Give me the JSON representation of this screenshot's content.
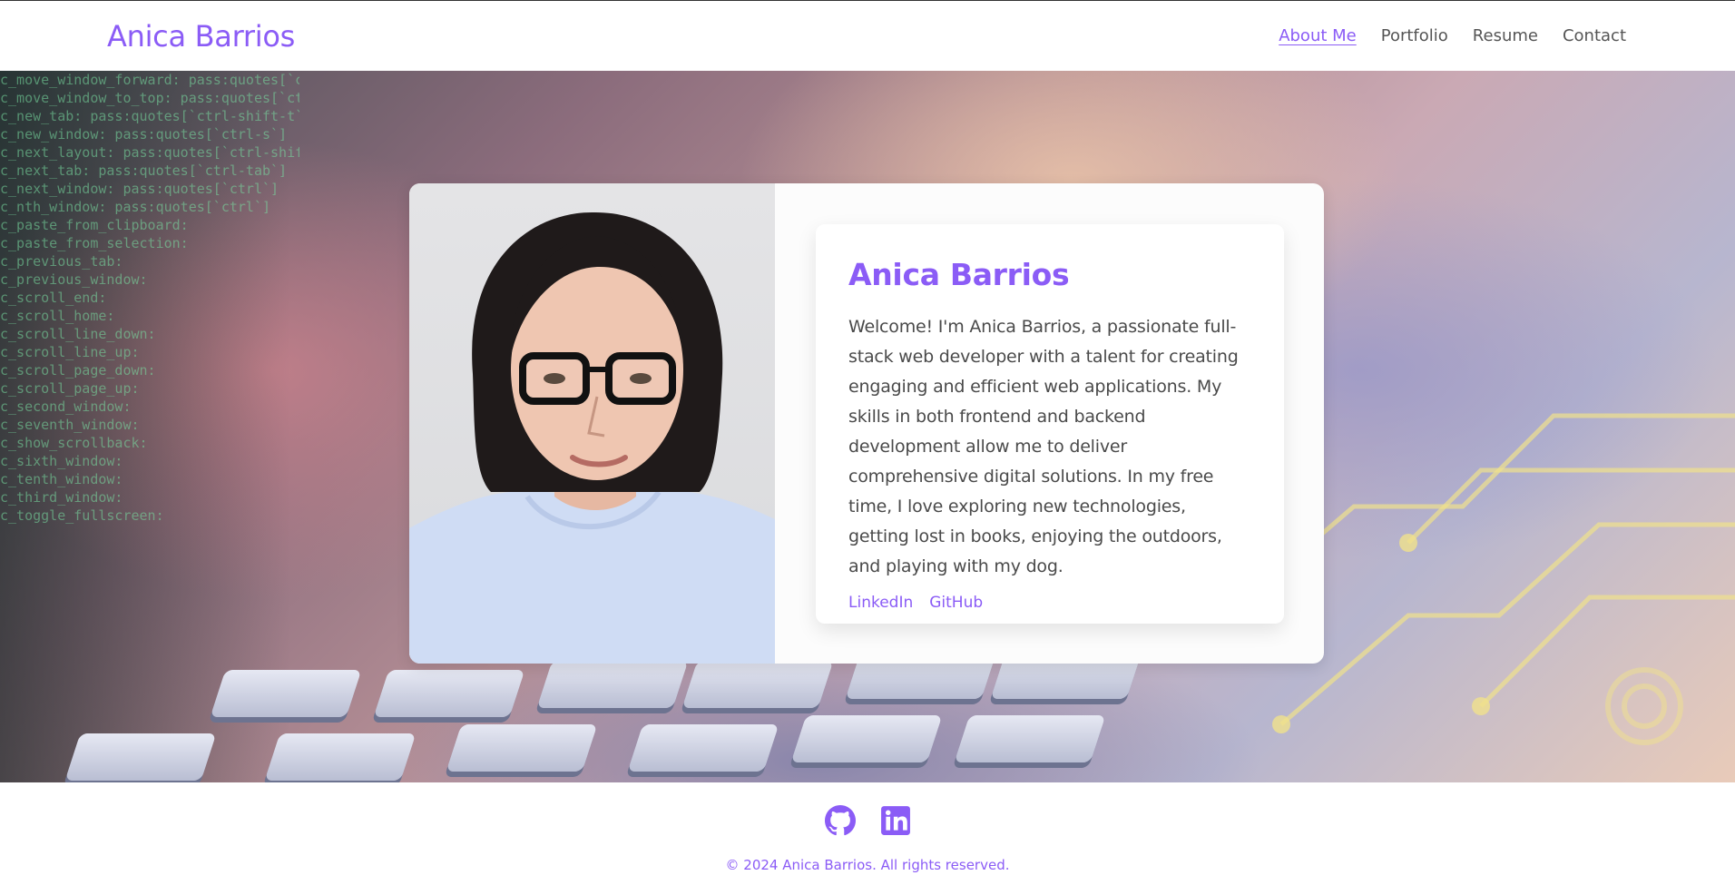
{
  "header": {
    "brand": "Anica Barrios",
    "nav": [
      {
        "label": "About Me",
        "active": true
      },
      {
        "label": "Portfolio",
        "active": false
      },
      {
        "label": "Resume",
        "active": false
      },
      {
        "label": "Contact",
        "active": false
      }
    ]
  },
  "hero": {
    "background_code": [
      "c_move_window_forward: pass:quotes[`ctrl-shift`]",
      "c_move_window_to_top: pass:quotes[`ctrl-sh`]",
      "c_new_tab: pass:quotes[`ctrl-shift-t`]",
      "c_new_window: pass:quotes[`ctrl-s`]",
      "c_next_layout: pass:quotes[`ctrl-shift`]",
      "c_next_tab: pass:quotes[`ctrl-tab`]",
      "c_next_window: pass:quotes[`ctrl`]",
      "c_nth_window: pass:quotes[`ctrl`]",
      "c_paste_from_clipboard:",
      "c_paste_from_selection:",
      "c_previous_tab:",
      "c_previous_window:",
      "c_scroll_end:",
      "c_scroll_home:",
      "c_scroll_line_down:",
      "c_scroll_line_up:",
      "c_scroll_page_down:",
      "c_scroll_page_up:",
      "c_second_window:",
      "c_seventh_window:",
      "c_show_scrollback:",
      "c_sixth_window:",
      "c_tenth_window:",
      "c_third_window:",
      "c_toggle_fullscreen:"
    ]
  },
  "profile": {
    "name": "Anica Barrios",
    "bio": "Welcome! I'm Anica Barrios, a passionate full-stack web developer with a talent for creating engaging and efficient web applications. My skills in both frontend and backend development allow me to deliver comprehensive digital solutions. In my free time, I love exploring new technologies, getting lost in books, enjoying the outdoors, and playing with my dog.",
    "links": [
      "LinkedIn",
      "GitHub"
    ]
  },
  "footer": {
    "social": [
      "github-icon",
      "linkedin-icon"
    ],
    "copyright": "© 2024 Anica Barrios. All rights reserved."
  },
  "colors": {
    "accent": "#8b5cf6",
    "text": "#4a4a4a"
  }
}
